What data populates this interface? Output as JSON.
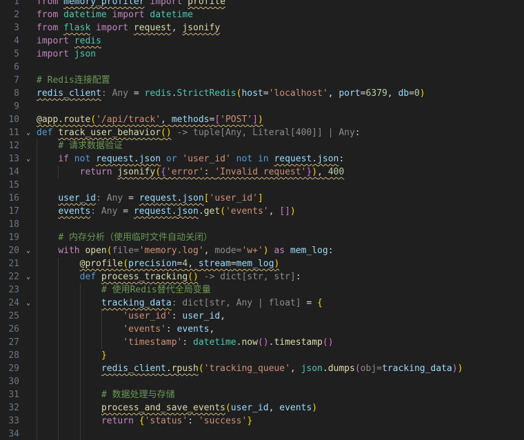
{
  "editor": {
    "language": "python",
    "lines": [
      {
        "n": "1",
        "indent": 0,
        "fold": false,
        "tokens": [
          [
            "kw",
            "from"
          ],
          [
            "pl",
            " "
          ],
          [
            "var",
            "memory_profiler",
            1
          ],
          [
            "pl",
            " "
          ],
          [
            "kw",
            "import"
          ],
          [
            "pl",
            " "
          ],
          [
            "fn",
            "profile",
            1
          ]
        ]
      },
      {
        "n": "2",
        "indent": 0,
        "fold": false,
        "tokens": [
          [
            "kw",
            "from"
          ],
          [
            "pl",
            " "
          ],
          [
            "cls",
            "datetime"
          ],
          [
            "pl",
            " "
          ],
          [
            "kw",
            "import"
          ],
          [
            "pl",
            " "
          ],
          [
            "cls",
            "datetime"
          ]
        ]
      },
      {
        "n": "3",
        "indent": 0,
        "fold": false,
        "tokens": [
          [
            "kw",
            "from"
          ],
          [
            "pl",
            " "
          ],
          [
            "cls",
            "flask",
            1
          ],
          [
            "pl",
            " "
          ],
          [
            "kw",
            "import"
          ],
          [
            "pl",
            " "
          ],
          [
            "fn",
            "request",
            1
          ],
          [
            "pl",
            ", "
          ],
          [
            "fn",
            "jsonify",
            1
          ]
        ]
      },
      {
        "n": "4",
        "indent": 0,
        "fold": false,
        "tokens": [
          [
            "kw",
            "import"
          ],
          [
            "pl",
            " "
          ],
          [
            "cls",
            "redis",
            1
          ]
        ]
      },
      {
        "n": "5",
        "indent": 0,
        "fold": false,
        "tokens": [
          [
            "kw",
            "import"
          ],
          [
            "pl",
            " "
          ],
          [
            "cls",
            "json"
          ]
        ]
      },
      {
        "n": "6",
        "indent": 0,
        "fold": false,
        "tokens": []
      },
      {
        "n": "7",
        "indent": 0,
        "fold": false,
        "tokens": [
          [
            "com",
            "# Redis连接配置"
          ]
        ]
      },
      {
        "n": "8",
        "indent": 0,
        "fold": false,
        "tokens": [
          [
            "var",
            "redis_client",
            1
          ],
          [
            "hint",
            ": Any"
          ],
          [
            "pl",
            " = "
          ],
          [
            "cls",
            "redis"
          ],
          [
            "pl",
            "."
          ],
          [
            "cls",
            "StrictRedis"
          ],
          [
            "br1",
            "("
          ],
          [
            "var",
            "host"
          ],
          [
            "pl",
            "="
          ],
          [
            "str",
            "'localhost'"
          ],
          [
            "pl",
            ", "
          ],
          [
            "var",
            "port"
          ],
          [
            "pl",
            "="
          ],
          [
            "num",
            "6379"
          ],
          [
            "pl",
            ", "
          ],
          [
            "var",
            "db"
          ],
          [
            "pl",
            "="
          ],
          [
            "num",
            "0"
          ],
          [
            "br1",
            ")"
          ]
        ]
      },
      {
        "n": "9",
        "indent": 0,
        "fold": false,
        "tokens": []
      },
      {
        "n": "10",
        "indent": 0,
        "fold": false,
        "tokens": [
          [
            "fn",
            "@app.route",
            1
          ],
          [
            "br1",
            "(",
            1
          ],
          [
            "str",
            "'/api/track'",
            1
          ],
          [
            "pl",
            ", ",
            1
          ],
          [
            "var",
            "methods",
            1
          ],
          [
            "pl",
            "=",
            1
          ],
          [
            "br2",
            "[",
            1
          ],
          [
            "str",
            "'POST'",
            1
          ],
          [
            "br2",
            "]",
            1
          ],
          [
            "br1",
            ")",
            1
          ]
        ]
      },
      {
        "n": "11",
        "indent": 0,
        "fold": true,
        "tokens": [
          [
            "kw2",
            "def"
          ],
          [
            "pl",
            " "
          ],
          [
            "fn",
            "track_user_behavior",
            1
          ],
          [
            "br1",
            "()",
            1
          ],
          [
            "hint",
            " -> tuple[Any, Literal[400]] | Any"
          ],
          [
            "pl",
            ":"
          ]
        ]
      },
      {
        "n": "12",
        "indent": 1,
        "fold": false,
        "tokens": [
          [
            "com",
            "# 请求数据验证"
          ]
        ]
      },
      {
        "n": "13",
        "indent": 1,
        "fold": true,
        "tokens": [
          [
            "kw",
            "if"
          ],
          [
            "pl",
            " "
          ],
          [
            "kw2",
            "not"
          ],
          [
            "pl",
            " "
          ],
          [
            "var",
            "request",
            1
          ],
          [
            "pl",
            ".",
            1
          ],
          [
            "var",
            "json",
            1
          ],
          [
            "pl",
            " "
          ],
          [
            "kw2",
            "or"
          ],
          [
            "pl",
            " "
          ],
          [
            "str",
            "'user_id'"
          ],
          [
            "pl",
            " "
          ],
          [
            "kw2",
            "not in"
          ],
          [
            "pl",
            " "
          ],
          [
            "var",
            "request",
            1
          ],
          [
            "pl",
            ".",
            1
          ],
          [
            "var",
            "json",
            1
          ],
          [
            "pl",
            ":"
          ]
        ]
      },
      {
        "n": "14",
        "indent": 2,
        "fold": false,
        "tokens": [
          [
            "kw",
            "return"
          ],
          [
            "pl",
            " "
          ],
          [
            "fn",
            "jsonify",
            1
          ],
          [
            "br1",
            "(",
            1
          ],
          [
            "br2",
            "{",
            1
          ],
          [
            "str",
            "'error'",
            1
          ],
          [
            "pl",
            ": ",
            1
          ],
          [
            "str",
            "'Invalid request'",
            1
          ],
          [
            "br2",
            "}",
            1
          ],
          [
            "br1",
            ")",
            1
          ],
          [
            "pl",
            ", ",
            1
          ],
          [
            "num",
            "400",
            1
          ]
        ]
      },
      {
        "n": "15",
        "indent": 1,
        "fold": false,
        "tokens": []
      },
      {
        "n": "16",
        "indent": 1,
        "fold": false,
        "tokens": [
          [
            "var",
            "user_id",
            1
          ],
          [
            "hint",
            ": Any"
          ],
          [
            "pl",
            " = "
          ],
          [
            "var",
            "request",
            1
          ],
          [
            "pl",
            ".",
            1
          ],
          [
            "var",
            "json",
            1
          ],
          [
            "br1",
            "["
          ],
          [
            "str",
            "'user_id'"
          ],
          [
            "br1",
            "]"
          ]
        ]
      },
      {
        "n": "17",
        "indent": 1,
        "fold": false,
        "tokens": [
          [
            "var",
            "events",
            1
          ],
          [
            "hint",
            ": Any"
          ],
          [
            "pl",
            " = "
          ],
          [
            "var",
            "request",
            1
          ],
          [
            "pl",
            ".",
            1
          ],
          [
            "var",
            "json",
            1
          ],
          [
            "pl",
            "."
          ],
          [
            "fn",
            "get"
          ],
          [
            "br1",
            "("
          ],
          [
            "str",
            "'events'"
          ],
          [
            "pl",
            ", "
          ],
          [
            "br2",
            "[]"
          ],
          [
            "br1",
            ")"
          ]
        ]
      },
      {
        "n": "18",
        "indent": 1,
        "fold": false,
        "tokens": []
      },
      {
        "n": "19",
        "indent": 1,
        "fold": false,
        "tokens": [
          [
            "com",
            "# 内存分析（使用临时文件自动关闭）"
          ]
        ]
      },
      {
        "n": "20",
        "indent": 1,
        "fold": true,
        "tokens": [
          [
            "kw",
            "with"
          ],
          [
            "pl",
            " "
          ],
          [
            "fn",
            "open"
          ],
          [
            "br1",
            "("
          ],
          [
            "hint",
            "file="
          ],
          [
            "str",
            "'memory.log'"
          ],
          [
            "pl",
            ", "
          ],
          [
            "hint",
            "mode="
          ],
          [
            "str",
            "'w+'"
          ],
          [
            "br1",
            ")"
          ],
          [
            "pl",
            " "
          ],
          [
            "kw",
            "as"
          ],
          [
            "pl",
            " "
          ],
          [
            "var",
            "mem_log"
          ],
          [
            "pl",
            ":"
          ]
        ]
      },
      {
        "n": "21",
        "indent": 2,
        "fold": false,
        "tokens": [
          [
            "fn",
            "@profile",
            1
          ],
          [
            "br1",
            "(",
            1
          ],
          [
            "var",
            "precision",
            1
          ],
          [
            "pl",
            "=",
            1
          ],
          [
            "num",
            "4",
            1
          ],
          [
            "pl",
            ", ",
            1
          ],
          [
            "var",
            "stream",
            1
          ],
          [
            "pl",
            "=",
            1
          ],
          [
            "var",
            "mem_log",
            1
          ],
          [
            "br1",
            ")",
            1
          ]
        ]
      },
      {
        "n": "22",
        "indent": 2,
        "fold": true,
        "tokens": [
          [
            "kw2",
            "def"
          ],
          [
            "pl",
            " "
          ],
          [
            "fn",
            "process_tracking",
            1
          ],
          [
            "br1",
            "()",
            1
          ],
          [
            "hint",
            " -> dict[str, str]"
          ],
          [
            "pl",
            ":"
          ]
        ]
      },
      {
        "n": "23",
        "indent": 3,
        "fold": false,
        "tokens": [
          [
            "com",
            "# 使用Redis替代全局变量"
          ]
        ]
      },
      {
        "n": "24",
        "indent": 3,
        "fold": true,
        "tokens": [
          [
            "var",
            "tracking_data",
            1
          ],
          [
            "hint",
            ": dict[str, Any | float]"
          ],
          [
            "pl",
            " = "
          ],
          [
            "br1",
            "{"
          ]
        ]
      },
      {
        "n": "25",
        "indent": 4,
        "fold": false,
        "tokens": [
          [
            "str",
            "'user_id'"
          ],
          [
            "pl",
            ": "
          ],
          [
            "var",
            "user_id"
          ],
          [
            "pl",
            ","
          ]
        ]
      },
      {
        "n": "26",
        "indent": 4,
        "fold": false,
        "tokens": [
          [
            "str",
            "'events'"
          ],
          [
            "pl",
            ": "
          ],
          [
            "var",
            "events"
          ],
          [
            "pl",
            ","
          ]
        ]
      },
      {
        "n": "27",
        "indent": 4,
        "fold": false,
        "tokens": [
          [
            "str",
            "'timestamp'"
          ],
          [
            "pl",
            ": "
          ],
          [
            "cls",
            "datetime"
          ],
          [
            "pl",
            "."
          ],
          [
            "fn",
            "now"
          ],
          [
            "br2",
            "()"
          ],
          [
            "pl",
            "."
          ],
          [
            "fn",
            "timestamp"
          ],
          [
            "br2",
            "()"
          ]
        ]
      },
      {
        "n": "28",
        "indent": 3,
        "fold": false,
        "tokens": [
          [
            "br1",
            "}"
          ]
        ]
      },
      {
        "n": "29",
        "indent": 3,
        "fold": false,
        "tokens": [
          [
            "var",
            "redis_client",
            1
          ],
          [
            "pl",
            ".",
            1
          ],
          [
            "fn",
            "rpush",
            1
          ],
          [
            "br1",
            "("
          ],
          [
            "str",
            "'tracking_queue'"
          ],
          [
            "pl",
            ", "
          ],
          [
            "cls",
            "json"
          ],
          [
            "pl",
            "."
          ],
          [
            "fn",
            "dumps"
          ],
          [
            "br2",
            "("
          ],
          [
            "hint",
            "obj="
          ],
          [
            "var",
            "tracking_data"
          ],
          [
            "br2",
            ")"
          ],
          [
            "br1",
            ")"
          ]
        ]
      },
      {
        "n": "30",
        "indent": 3,
        "fold": false,
        "tokens": []
      },
      {
        "n": "31",
        "indent": 3,
        "fold": false,
        "tokens": [
          [
            "com",
            "# 数据处理与存储"
          ]
        ]
      },
      {
        "n": "32",
        "indent": 3,
        "fold": false,
        "tokens": [
          [
            "fn",
            "process_and_save_events",
            1
          ],
          [
            "br1",
            "("
          ],
          [
            "var",
            "user_id"
          ],
          [
            "pl",
            ", "
          ],
          [
            "var",
            "events"
          ],
          [
            "br1",
            ")"
          ]
        ]
      },
      {
        "n": "33",
        "indent": 3,
        "fold": false,
        "tokens": [
          [
            "kw",
            "return"
          ],
          [
            "pl",
            " "
          ],
          [
            "br1",
            "{"
          ],
          [
            "str",
            "'status'"
          ],
          [
            "pl",
            ": "
          ],
          [
            "str",
            "'success'"
          ],
          [
            "br1",
            "}"
          ]
        ]
      },
      {
        "n": "34",
        "indent": 3,
        "fold": false,
        "tokens": []
      }
    ]
  }
}
